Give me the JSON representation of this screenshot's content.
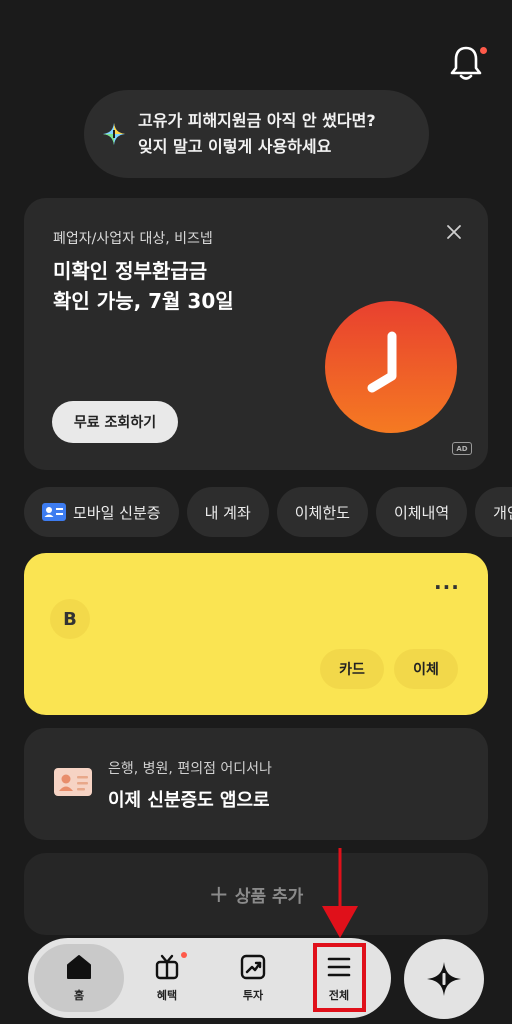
{
  "header": {
    "has_notification": true
  },
  "promo": {
    "line1": "고유가 피해지원금 아직 안 썼다면?",
    "line2": "잊지 말고 이렇게 사용하세요"
  },
  "ad": {
    "subtitle": "폐업자/사업자 대상, 비즈넵",
    "title_line1": "미확인 정부환급금",
    "title_line2": "확인 가능, 7월 30일",
    "button_label": "무료 조회하기",
    "badge": "AD",
    "accent_color": "#f05a28"
  },
  "chips": [
    {
      "label": "모바일 신분증",
      "icon": "id-card-icon"
    },
    {
      "label": "내 계좌"
    },
    {
      "label": "이체한도"
    },
    {
      "label": "이체내역"
    },
    {
      "label": "개인"
    }
  ],
  "bank_card": {
    "logo_letter": "B",
    "more": "···",
    "card_button": "카드",
    "transfer_button": "이체",
    "color": "#fae452"
  },
  "id_card": {
    "subtitle": "은행, 병원, 편의점 어디서나",
    "title": "이제 신분증도 앱으로"
  },
  "add_product": {
    "label": "상품 추가"
  },
  "tabs": [
    {
      "label": "홈",
      "active": true
    },
    {
      "label": "혜택",
      "badge": true
    },
    {
      "label": "투자"
    },
    {
      "label": "전체",
      "highlighted": true
    }
  ]
}
